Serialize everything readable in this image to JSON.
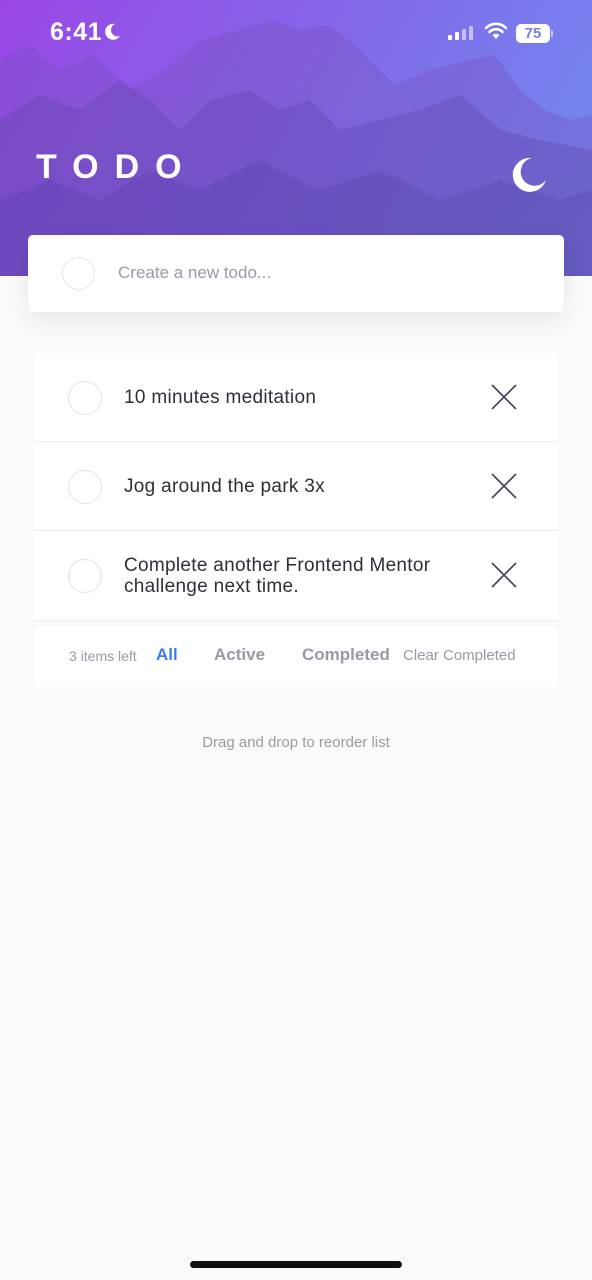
{
  "status_bar": {
    "time": "6:41",
    "battery": "75"
  },
  "header": {
    "title": "TODO"
  },
  "new_todo": {
    "placeholder": "Create a new todo..."
  },
  "todos": [
    {
      "text": "10 minutes meditation",
      "completed": false
    },
    {
      "text": "Jog around the park 3x",
      "completed": false
    },
    {
      "text": "Complete another Frontend Mentor challenge next time.",
      "completed": false
    }
  ],
  "footer": {
    "items_left": "3 items left",
    "filters": [
      "All",
      "Active",
      "Completed"
    ],
    "selected_filter": "All",
    "clear_label": "Clear Completed"
  },
  "hint": "Drag and drop to reorder list",
  "colors": {
    "accent": "#3a7bfd",
    "gradient_start": "#9b47e6",
    "gradient_end": "#6f8df0",
    "background": "#fafafa"
  },
  "icons": {
    "theme_toggle": "moon-icon",
    "delete": "cross-icon"
  }
}
